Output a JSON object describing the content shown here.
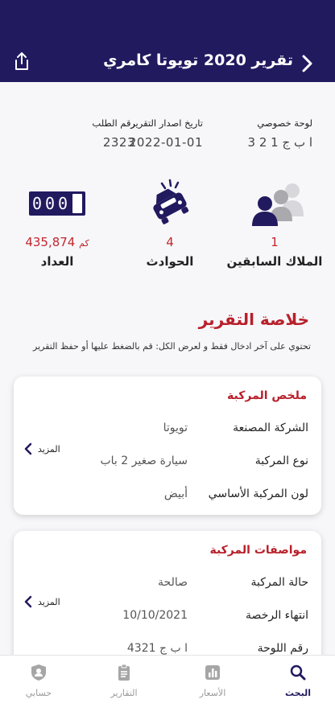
{
  "header": {
    "title": "تقرير 2020 تويوتا كامري"
  },
  "info": {
    "plate_label": "لوحة خصوصي",
    "plate_value": "ا ب ج 1 2 3",
    "date_label": "تاريخ اصدار التقرير",
    "date_value": "2022-01-01",
    "order_label": "رقم الطلب",
    "order_value": "2323"
  },
  "stats": {
    "owners_count": "1",
    "owners_label": "الملاك السابقين",
    "accidents_count": "4",
    "accidents_label": "الحوادث",
    "odometer_value": "435,874",
    "odometer_unit": "كم",
    "odometer_label": "العداد",
    "odometer_display": "000"
  },
  "summary": {
    "title": "خلاصة التقرير",
    "subtitle": "تحتوي على آخر ادخال فقط و لعرض الكل: قم بالضغط عليها أو حفظ التقرير"
  },
  "card1": {
    "title": "ملخص المركبة",
    "rows": [
      {
        "key": "الشركة المصنعة",
        "value": "تويوتا"
      },
      {
        "key": "نوع المركبة",
        "value": "سيارة صغير 2 باب"
      },
      {
        "key": "لون المركبة الأساسي",
        "value": "أبيض"
      }
    ],
    "more": "المزيد"
  },
  "card2": {
    "title": "مواصفات المركبة",
    "rows": [
      {
        "key": "حالة المركبة",
        "value": "صالحة"
      },
      {
        "key": "انتهاء الرخصة",
        "value": "10/10/2021"
      },
      {
        "key": "رقم اللوحة",
        "value": "ا ب ج 4321"
      }
    ],
    "more": "المزيد"
  },
  "nav": {
    "search": "البحث",
    "prices": "الأسعار",
    "reports": "التقارير",
    "account": "حسابي"
  },
  "colors": {
    "primary": "#211a5f",
    "accent": "#b8202a"
  }
}
